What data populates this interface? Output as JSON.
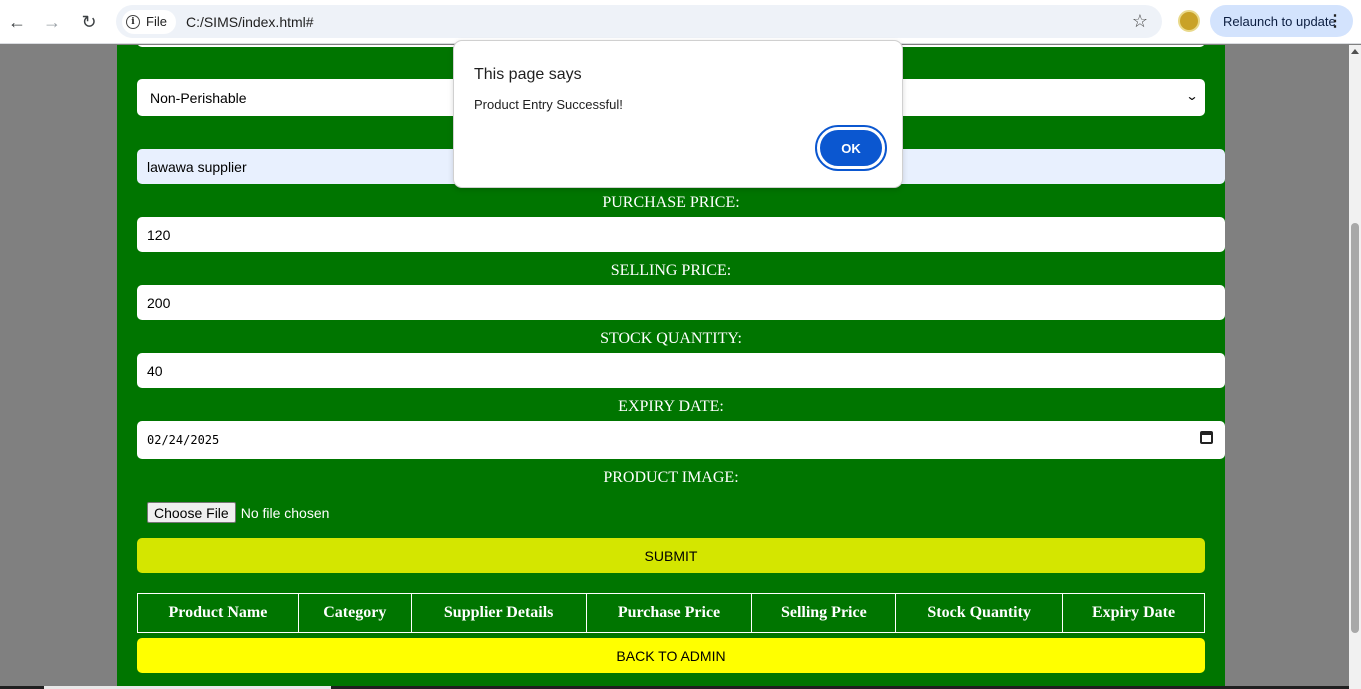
{
  "browser": {
    "site_chip": "File",
    "url": "C:/SIMS/index.html#",
    "relaunch_label": "Relaunch to update",
    "back_icon": "arrow-left",
    "forward_icon": "arrow-right",
    "reload_icon": "reload",
    "star_icon": "star-outline",
    "menu_icon": "kebab-vertical"
  },
  "form": {
    "category_value": "Non-Perishable",
    "supplier_value": "lawawa supplier",
    "purchase_price_label": "PURCHASE PRICE:",
    "purchase_price_value": "120",
    "selling_price_label": "SELLING PRICE:",
    "selling_price_value": "200",
    "stock_quantity_label": "STOCK QUANTITY:",
    "stock_quantity_value": "40",
    "expiry_date_label": "EXPIRY DATE:",
    "expiry_date_value": "02/24/2025",
    "product_image_label": "PRODUCT IMAGE:",
    "choose_file_label": "Choose File",
    "no_file_text": "No file chosen",
    "submit_label": "SUBMIT",
    "back_label": "BACK TO ADMIN"
  },
  "table": {
    "headers": [
      "Product Name",
      "Category",
      "Supplier Details",
      "Purchase Price",
      "Selling Price",
      "Stock Quantity",
      "Expiry Date"
    ]
  },
  "dialog": {
    "title": "This page says",
    "message": "Product Entry Successful!",
    "ok_label": "OK"
  },
  "colors": {
    "panel": "#007500",
    "submit": "#d4e600",
    "back": "#ffff00",
    "ok_button": "#0b57d0"
  }
}
